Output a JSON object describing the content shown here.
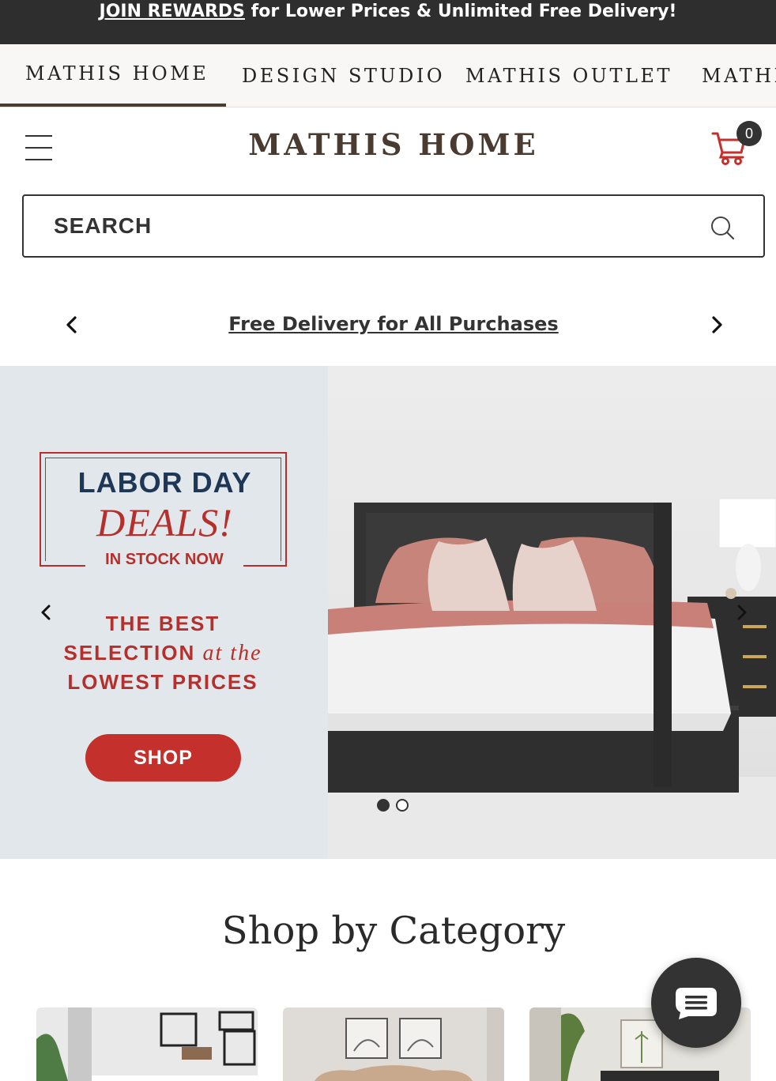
{
  "promo_bar": {
    "link_text": "JOIN REWARDS",
    "text": " for Lower Prices & Unlimited Free Delivery!"
  },
  "brand_tabs": [
    {
      "label": "MATHIS HOME",
      "active": true
    },
    {
      "label": "DESIGN STUDIO",
      "active": false
    },
    {
      "label": "MATHIS OUTLET",
      "active": false
    },
    {
      "label": "MATHIS",
      "active": false
    }
  ],
  "header": {
    "menu_icon": "hamburger-icon",
    "logo": "MATHIS HOME",
    "cart_icon": "cart-icon",
    "cart_count": "0"
  },
  "search": {
    "placeholder": "SEARCH",
    "icon": "search-icon"
  },
  "announcement": {
    "text": "Free Delivery for All Purchases",
    "prev_icon": "chevron-left-icon",
    "next_icon": "chevron-right-icon"
  },
  "hero": {
    "badge_line1": "LABOR DAY",
    "badge_line2": "DEALS!",
    "badge_line3": "IN STOCK NOW",
    "tagline_line1": "THE BEST",
    "tagline_line2a": "SELECTION",
    "tagline_line2b": "at the",
    "tagline_line3": "LOWEST PRICES",
    "shop_button": "SHOP",
    "slide_count": 2,
    "active_slide": 1
  },
  "category": {
    "title": "Shop by Category"
  },
  "chat": {
    "icon": "chat-icon"
  },
  "colors": {
    "promo_bg": "#2e2e2e",
    "brand": "#4a3b31",
    "accent_red": "#c4302b",
    "navy": "#1e3756",
    "hero_panel": "#e1e7eb"
  }
}
